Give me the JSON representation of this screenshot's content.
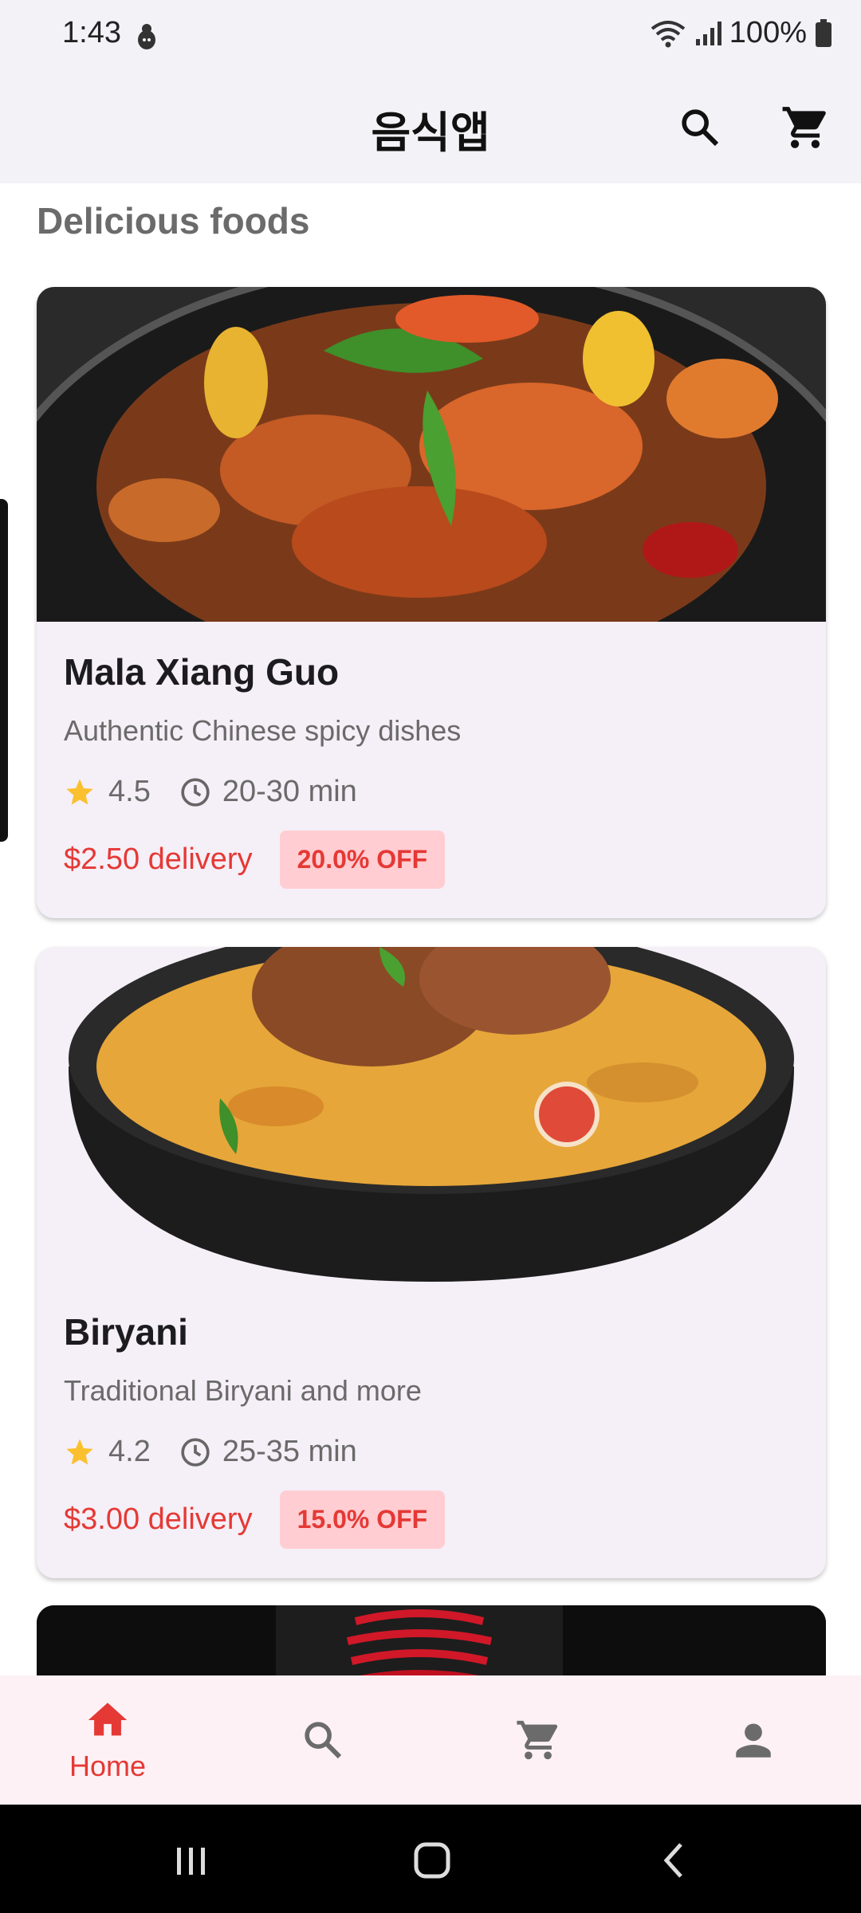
{
  "status_bar": {
    "time": "1:43",
    "battery": "100%"
  },
  "app_bar": {
    "title": "음식앱"
  },
  "section_title": "Delicious foods",
  "restaurants": [
    {
      "name": "Mala Xiang Guo",
      "description": "Authentic Chinese spicy dishes",
      "rating": "4.5",
      "time": "20-30 min",
      "delivery": "$2.50 delivery",
      "discount": "20.0% OFF"
    },
    {
      "name": "Biryani",
      "description": "Traditional Biryani and more",
      "rating": "4.2",
      "time": "25-35 min",
      "delivery": "$3.00 delivery",
      "discount": "15.0% OFF"
    }
  ],
  "bottom_nav": {
    "items": [
      {
        "label": "Home",
        "icon": "home-icon",
        "active": true
      },
      {
        "icon": "search-icon"
      },
      {
        "icon": "cart-icon"
      },
      {
        "icon": "person-icon"
      }
    ]
  },
  "colors": {
    "accent": "#e53935",
    "star": "#fbc02d",
    "card_bg": "#f5eff7",
    "bar_bg": "#f3f2f7"
  }
}
